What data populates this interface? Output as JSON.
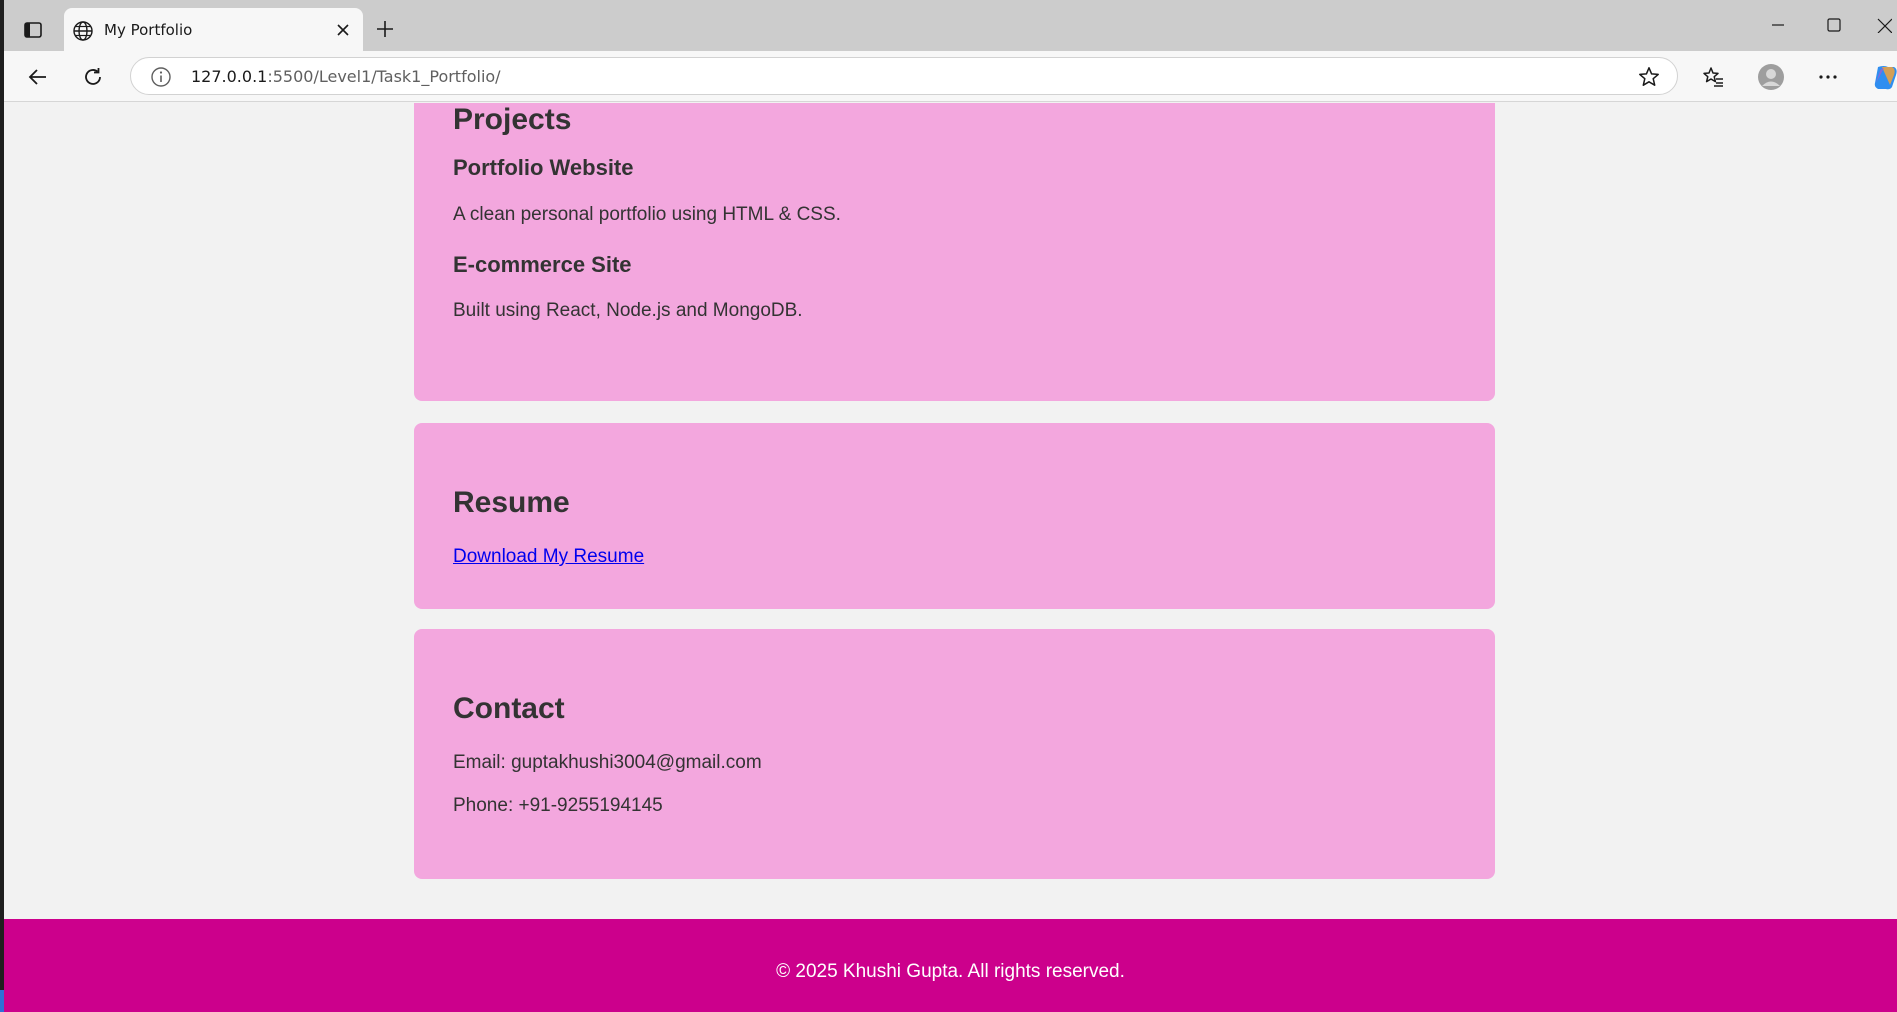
{
  "browser": {
    "tab_title": "My Portfolio",
    "url_host": "127.0.0.1",
    "url_rest": ":5500/Level1/Task1_Portfolio/",
    "icons": {
      "sidebar": "sidebar-toggle-icon",
      "tab": "globe-icon",
      "close": "close-icon",
      "new_tab": "plus-icon",
      "back": "back-arrow-icon",
      "refresh": "refresh-icon",
      "info": "info-icon",
      "star": "star-icon",
      "favorites": "favorites-icon",
      "profile": "profile-icon",
      "more": "more-icon",
      "copilot": "copilot-icon"
    }
  },
  "projects": {
    "heading": "Projects",
    "items": [
      {
        "title": "Portfolio Website",
        "description": "A clean personal portfolio using HTML & CSS."
      },
      {
        "title": "E-commerce Site",
        "description": "Built using React, Node.js and MongoDB."
      }
    ]
  },
  "resume": {
    "heading": "Resume",
    "link_label": "Download My Resume"
  },
  "contact": {
    "heading": "Contact",
    "email": "Email: guptakhushi3004@gmail.com",
    "phone": "Phone: +91-9255194145"
  },
  "footer": {
    "text": "© 2025 Khushi Gupta. All rights reserved."
  },
  "colors": {
    "card": "#f3a7de",
    "footer": "#cc008c",
    "page_bg": "#f2f2f2",
    "link": "#0000ee"
  }
}
